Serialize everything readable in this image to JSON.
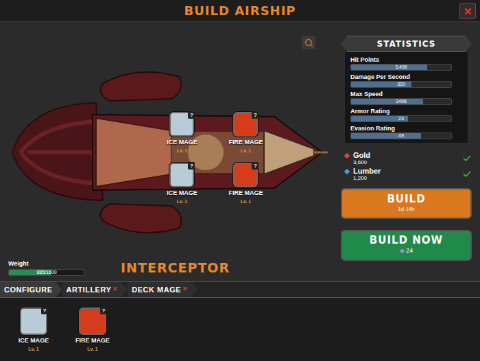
{
  "window": {
    "title": "BUILD AIRSHIP",
    "close": "✕"
  },
  "ship": {
    "name": "INTERCEPTOR",
    "slots": [
      {
        "name": "ICE MAGE",
        "level": "Lv. 1",
        "badge": "?",
        "color": "#b8ccd8"
      },
      {
        "name": "FIRE MAGE",
        "level": "Lv. 1",
        "badge": "?",
        "color": "#d63c1c"
      },
      {
        "name": "ICE MAGE",
        "level": "Lv. 1",
        "badge": "?",
        "color": "#b8ccd8"
      },
      {
        "name": "FIRE MAGE",
        "level": "Lv. 1",
        "badge": "?",
        "color": "#d63c1c"
      }
    ],
    "weight": {
      "label": "Weight",
      "reading": "885/1600",
      "level": 0.553
    }
  },
  "statistics": {
    "title": "STATISTICS",
    "stats": [
      {
        "label": "Hit Points",
        "value": "3,496",
        "level": 0.76
      },
      {
        "label": "Damage Per Second",
        "value": "320",
        "level": 0.6
      },
      {
        "label": "Max Speed",
        "value": "1496",
        "level": 0.72
      },
      {
        "label": "Armor Rating",
        "value": "23",
        "level": 0.57
      },
      {
        "label": "Evasion Rating",
        "value": "49",
        "level": 0.7
      }
    ]
  },
  "resources": [
    {
      "name": "Gold",
      "amount": "3,600",
      "color": "#d94a3a",
      "met": true
    },
    {
      "name": "Lumber",
      "amount": "1,200",
      "color": "#3aa0d9",
      "met": true
    }
  ],
  "build": {
    "label": "BUILD",
    "time": "1d 14h"
  },
  "build_now": {
    "label": "BUILD NOW",
    "currency": "◆",
    "cost": "24"
  },
  "tabs": [
    {
      "label": "CONFIGURE",
      "mark": "",
      "selected": true
    },
    {
      "label": "ARTILLERY",
      "mark": "✕",
      "selected": false
    },
    {
      "label": "DECK MAGE",
      "mark": "✕",
      "selected": false
    }
  ],
  "tray": [
    {
      "name": "ICE MAGE",
      "level": "Lv. 1",
      "badge": "?",
      "color": "#b8ccd8"
    },
    {
      "name": "FIRE MAGE",
      "level": "Lv. 1",
      "badge": "?",
      "color": "#d63c1c"
    }
  ]
}
